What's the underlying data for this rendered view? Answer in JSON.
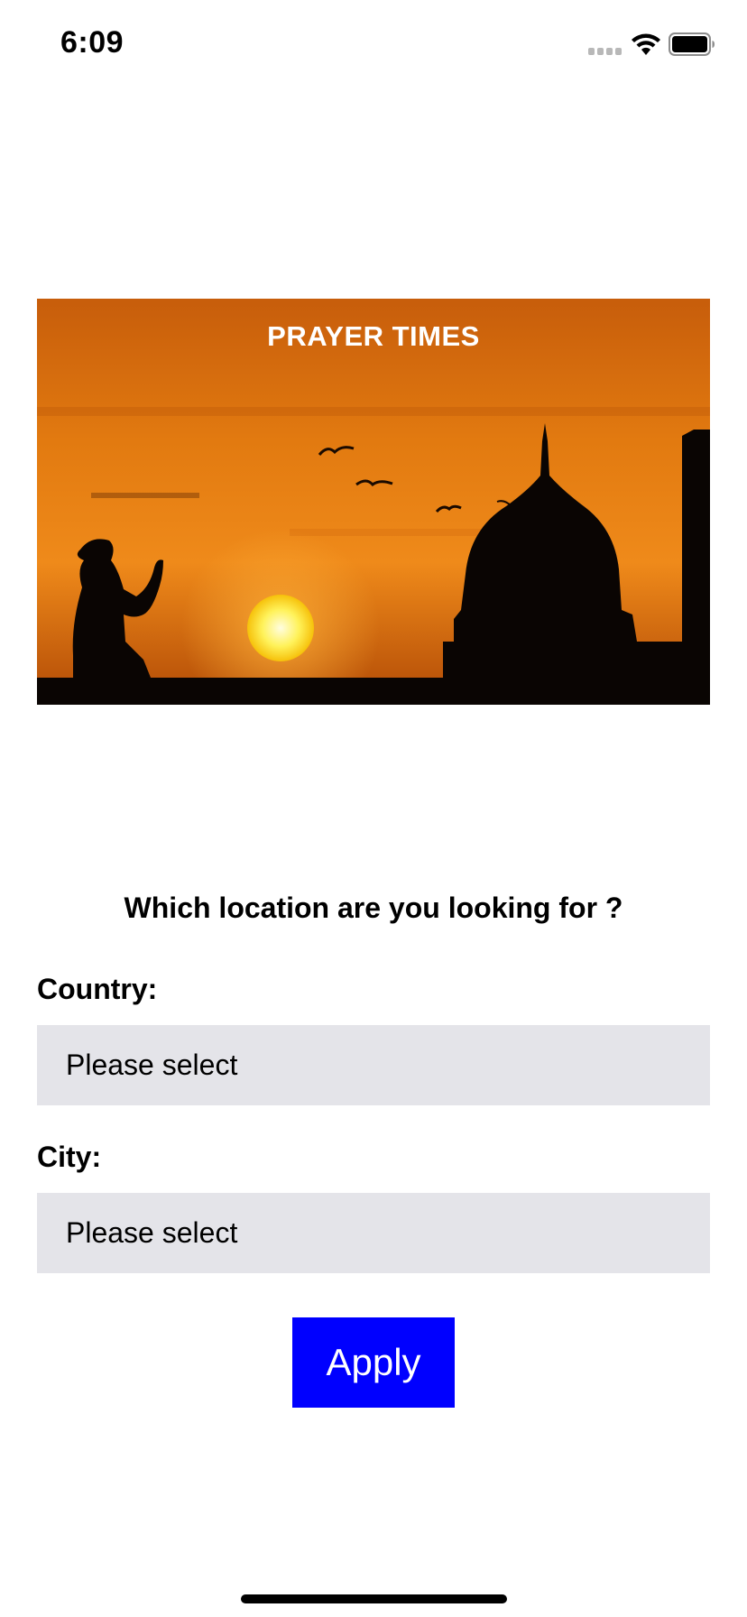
{
  "status_bar": {
    "time": "6:09",
    "icons": [
      "signal-icon",
      "wifi-icon",
      "battery-icon"
    ]
  },
  "banner": {
    "title": "PRAYER TIMES",
    "image": "sunset-mosque-silhouette"
  },
  "form": {
    "question": "Which location are you looking for ?",
    "country": {
      "label": "Country:",
      "value": "Please select"
    },
    "city": {
      "label": "City:",
      "value": "Please select"
    },
    "apply_label": "Apply"
  },
  "colors": {
    "apply_button": "#0000ff",
    "select_background": "#e4e4e9"
  }
}
